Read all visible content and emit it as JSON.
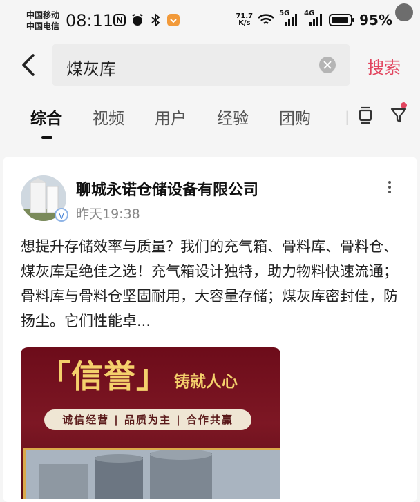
{
  "status_bar": {
    "carrier_1": "中国移动",
    "carrier_2": "中国电信",
    "time": "08:11",
    "net_speed_value": "71.7",
    "net_speed_unit": "K/s",
    "signal_5g": "5G",
    "signal_4g": "4G",
    "battery": "95%",
    "icons": [
      "nfc-icon",
      "alarm-icon",
      "bluetooth-icon",
      "shield-app-icon",
      "wifi-icon",
      "signal-icon",
      "battery-icon"
    ]
  },
  "search": {
    "query": "煤灰库",
    "button_label": "搜索"
  },
  "tabs": [
    {
      "label": "综合",
      "active": true
    },
    {
      "label": "视频",
      "active": false
    },
    {
      "label": "用户",
      "active": false
    },
    {
      "label": "经验",
      "active": false
    },
    {
      "label": "团购",
      "active": false
    }
  ],
  "post": {
    "author": "聊城永诺仓储设备有限公司",
    "time": "昨天19:38",
    "text": "想提升存储效率与质量？我们的充气箱、骨料库、骨料仓、煤灰库是绝佳之选！充气箱设计独特，助力物料快速流通；骨料库与骨料仓坚固耐用，大容量存储；煤灰库密封佳，防扬尘。它们性能卓...",
    "image": {
      "title": "「信誉」",
      "subtitle": "铸就人心",
      "slogan": "诚信经营 | 品质为主 | 合作共赢"
    }
  },
  "colors": {
    "accent": "#e2455f",
    "banner_bg": "#6d0c1a",
    "banner_gold": "#f4d06c"
  }
}
